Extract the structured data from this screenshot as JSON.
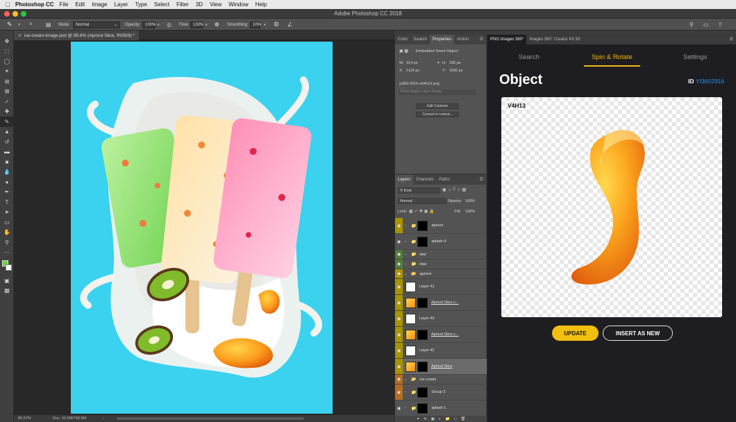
{
  "menubar": {
    "app_name": "Photoshop CC",
    "items": [
      "File",
      "Edit",
      "Image",
      "Layer",
      "Type",
      "Select",
      "Filter",
      "3D",
      "View",
      "Window",
      "Help"
    ]
  },
  "window": {
    "title": "Adobe Photoshop CC 2018"
  },
  "options_bar": {
    "brush_size": "6",
    "mode_label": "Mode:",
    "mode_value": "Normal",
    "opacity_label": "Opacity:",
    "opacity_value": "100%",
    "flow_label": "Flow:",
    "flow_value": "100%",
    "smoothing_label": "Smoothing:",
    "smoothing_value": "10%"
  },
  "document": {
    "tab_title": "ice-cream-image.psd @ 85.6% (Apricot Slice, RGB/8) *",
    "zoom": "85.57%",
    "doc_size": "Doc: 10.5M/758.9M"
  },
  "properties_panel": {
    "tabs": [
      "Color",
      "Swatch",
      "Properties",
      "Action"
    ],
    "active_tab": "Properties",
    "header": "Embedded Smart Object",
    "w_label": "W:",
    "w_value": "314 px",
    "h_label": "H:",
    "h_value": "336 px",
    "x_label": "X:",
    "x_value": "1124 px",
    "y_label": "Y:",
    "y_value": "1506 px",
    "filename": "yi360-2916-v04h13.png",
    "layer_comp": "Don't Apply Layer Comp",
    "edit_contents": "Edit Contents",
    "convert_linked": "Convert to Linked..."
  },
  "layers_panel": {
    "tabs": [
      "Layers",
      "Channels",
      "Paths"
    ],
    "active_tab": "Layers",
    "filter_kind": "Kind",
    "blend_mode": "Normal",
    "opacity_label": "Opacity:",
    "opacity_value": "100%",
    "lock_label": "Lock:",
    "fill_label": "Fill:",
    "fill_value": "100%",
    "layers": [
      {
        "name": "apricot",
        "type": "group-masked",
        "color": "#a79400",
        "short": false,
        "selected": false
      },
      {
        "name": "splash-4",
        "type": "group-masked",
        "color": "#535353",
        "short": false,
        "selected": false
      },
      {
        "name": "kiwi",
        "type": "folder",
        "color": "#4f7d3a",
        "short": true,
        "selected": false
      },
      {
        "name": "kiwi",
        "type": "folder",
        "color": "#4f7d3a",
        "short": true,
        "selected": false
      },
      {
        "name": "apricot",
        "type": "folder-open",
        "color": "#a79400",
        "short": true,
        "selected": false
      },
      {
        "name": "Layer 41",
        "type": "layer",
        "color": "#a79400",
        "short": false,
        "selected": false
      },
      {
        "name": "Apricot Slice c...",
        "type": "smart",
        "color": "#a79400",
        "short": false,
        "selected": false
      },
      {
        "name": "Layer 43",
        "type": "layer",
        "color": "#a79400",
        "short": false,
        "selected": false
      },
      {
        "name": "Apricot Slice c...",
        "type": "smart",
        "color": "#a79400",
        "short": false,
        "selected": false
      },
      {
        "name": "Layer 42",
        "type": "layer",
        "color": "#a79400",
        "short": false,
        "selected": false
      },
      {
        "name": "Apricot Slice",
        "type": "smart",
        "color": "#a79400",
        "short": false,
        "selected": true
      },
      {
        "name": "ice cream",
        "type": "folder-open",
        "color": "#b56d22",
        "short": true,
        "selected": false
      },
      {
        "name": "Group 3",
        "type": "group-masked",
        "color": "#b56d22",
        "short": false,
        "selected": false
      },
      {
        "name": "splash-1",
        "type": "group-masked",
        "color": "#535353",
        "short": false,
        "selected": false
      }
    ]
  },
  "plugin": {
    "tabs": [
      "PNG Images 360°",
      "Images 360° Creator Kit 3D"
    ],
    "active_tab": "PNG Images 360°",
    "nav": [
      "Search",
      "Spin & Rotate",
      "Settings"
    ],
    "active_nav": "Spin & Rotate",
    "title": "Object",
    "id_label": "ID",
    "id_value": "YI3602916",
    "preview_code": "V4H13",
    "update_label": "UPDATE",
    "insert_label": "INSERT AS NEW",
    "accent_color": "#f1b510",
    "link_color": "#2b8fea"
  }
}
